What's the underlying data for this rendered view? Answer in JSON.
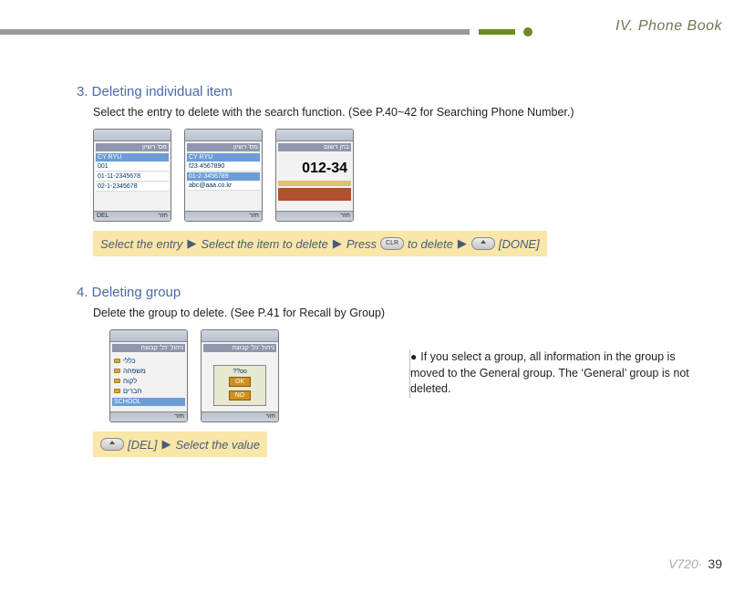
{
  "chapter": "IV. Phone Book",
  "section3": {
    "title": "3. Deleting individual item",
    "intro": "Select the entry to delete with the search function. (See P.40~42 for Searching Phone Number.)",
    "highlight": {
      "p1": "Select the entry",
      "p2": "Select the item to delete",
      "p3": "Press",
      "p4": "to delete",
      "p5": "[DONE]"
    },
    "phones": {
      "p1": {
        "top": "מס' רשיון",
        "r1": "CY RYU",
        "r2": "001",
        "r3": "01-11-2345678",
        "r4": "02-1-2345678",
        "bl": "DEL",
        "br": "חזר"
      },
      "p2": {
        "top": "מס' רשיון",
        "r1": "CY RYU",
        "r2": "f23·4567890",
        "r3": "01-2·3456789",
        "r4": "abc@aaa.co.kr",
        "bl": "",
        "br": "חזר"
      },
      "p3": {
        "top": "בחן רשום",
        "num": "012-34",
        "bl": "",
        "br": "חזר"
      }
    }
  },
  "section4": {
    "title": "4. Deleting group",
    "intro": "Delete the group to delete. (See P.41 for Recall by Group)",
    "note": "If you select a group, all information in the group is moved to the General group. The ‘General’ group is not deleted.",
    "highlight": {
      "p1": "[DEL]",
      "p2": "Select the value"
    },
    "phones": {
      "p1": {
        "top": "ניהול 'כל' קבוצה",
        "g1": "כללי",
        "g2": "משפחה",
        "g3": "לקוח",
        "g4": "חברים",
        "sel": "SCHOOL",
        "bl": "",
        "br": "חזר"
      },
      "p2": {
        "top": "ניהול 'כל' קבוצה",
        "dlg": "??oo",
        "b1": "OK",
        "b2": "NO",
        "bl": "",
        "br": "חזר"
      }
    }
  },
  "footer": {
    "model": "V720·",
    "page": "39"
  }
}
